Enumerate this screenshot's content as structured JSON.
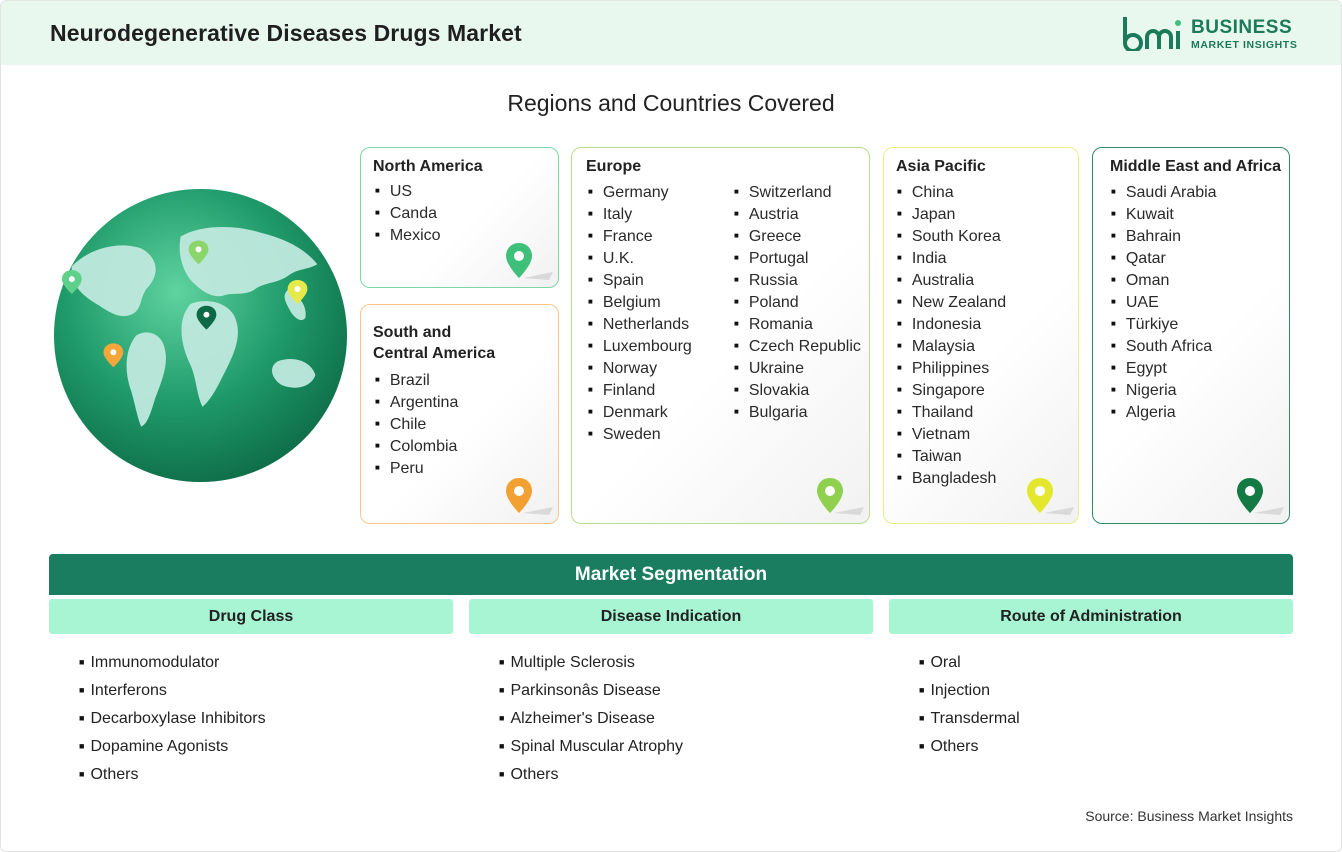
{
  "header": {
    "title": "Neurodegenerative Diseases Drugs Market"
  },
  "logo": {
    "line1": "BUSINESS",
    "line2": "MARKET INSIGHTS"
  },
  "regions": {
    "title": "Regions and Countries Covered",
    "north_america": {
      "title": "North America",
      "countries": [
        "US",
        "Canda",
        "Mexico"
      ]
    },
    "south_america": {
      "title_line1": "South and",
      "title_line2": "Central America",
      "countries": [
        "Brazil",
        "Argentina",
        "Chile",
        "Colombia",
        "Peru"
      ]
    },
    "europe": {
      "title": "Europe",
      "col1": [
        "Germany",
        "Italy",
        "France",
        "U.K.",
        "Spain",
        "Belgium",
        "Netherlands",
        "Luxembourg",
        "Norway",
        "Finland",
        "Denmark",
        "Sweden"
      ],
      "col2": [
        "Switzerland",
        "Austria",
        "Greece",
        "Portugal",
        "Russia",
        "Poland",
        "Romania",
        "Czech Republic",
        "Ukraine",
        "Slovakia",
        "Bulgaria"
      ]
    },
    "asia_pacific": {
      "title": "Asia Pacific",
      "countries": [
        "China",
        "Japan",
        "South Korea",
        "India",
        "Australia",
        "New Zealand",
        "Indonesia",
        "Malaysia",
        "Philippines",
        "Singapore",
        "Thailand",
        "Vietnam",
        "Taiwan",
        "Bangladesh"
      ]
    },
    "mea": {
      "title": "Middle East and Africa",
      "countries": [
        "Saudi Arabia",
        "Kuwait",
        "Bahrain",
        "Qatar",
        "Oman",
        "UAE",
        "Türkiye",
        "South Africa",
        "Egypt",
        "Nigeria",
        "Algeria"
      ]
    }
  },
  "segmentation": {
    "title": "Market Segmentation",
    "columns": [
      {
        "title": "Drug Class",
        "items": [
          "Immunomodulator",
          "Interferons",
          "Decarboxylase Inhibitors",
          "Dopamine Agonists",
          "Others"
        ]
      },
      {
        "title": "Disease Indication",
        "items": [
          "Multiple Sclerosis",
          "Parkinsonâs Disease",
          "Alzheimer's Disease",
          "Spinal Muscular Atrophy",
          "Others"
        ]
      },
      {
        "title": "Route of Administration",
        "items": [
          "Oral",
          "Injection",
          "Transdermal",
          "Others"
        ]
      }
    ]
  },
  "source": "Source: Business Market Insights",
  "colors": {
    "brand_green": "#1a7d60",
    "header_bg": "#e8f8ef",
    "segment_head_bg": "#a8f5d4",
    "north_america_border": "#7fd6a6",
    "south_america_border": "#f5c78a",
    "europe_border": "#b6e08e",
    "asia_pacific_border": "#eded88",
    "mea_border": "#2e8b64"
  }
}
